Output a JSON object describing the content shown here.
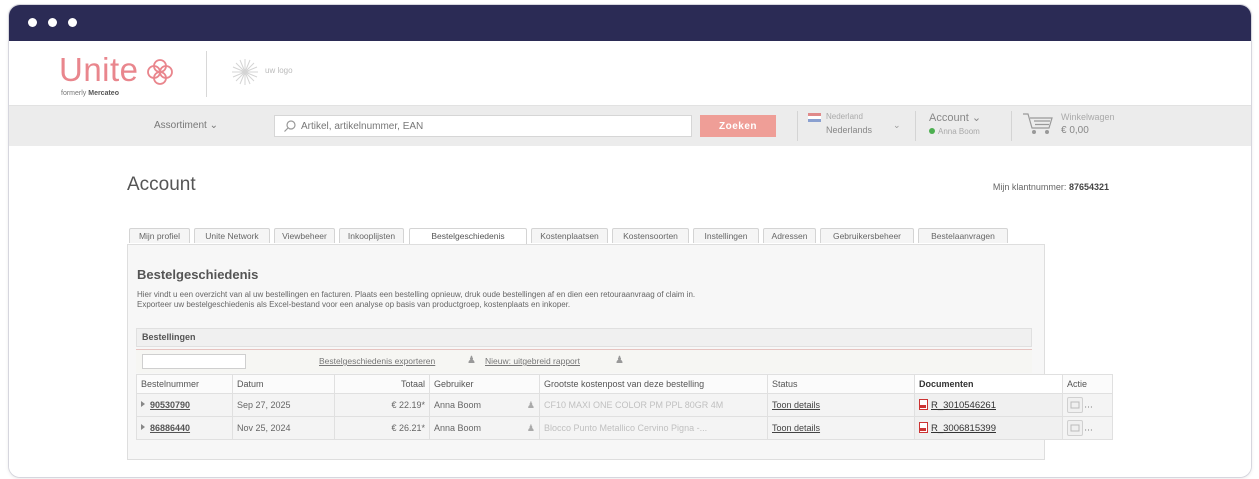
{
  "window": {
    "colors": {
      "titlebar": "#2b2b55",
      "brand": "#e9868d",
      "search_button": "#ef9e97"
    }
  },
  "header": {
    "logo_text": "Unite",
    "logo_formerly_prefix": "formerly",
    "logo_formerly_brand": "Mercateo",
    "uw_logo": "uw logo"
  },
  "nav": {
    "assortiment": "Assortiment",
    "search_placeholder": "Artikel, artikelnummer, EAN",
    "search_button": "Zoeken",
    "country": "Nederland",
    "language": "Nederlands",
    "account_label": "Account",
    "account_user": "Anna Boom",
    "cart_label": "Winkelwagen",
    "cart_total": "€ 0,00"
  },
  "page": {
    "title": "Account",
    "klant_label": "Mijn klantnummer:",
    "klant_number": "87654321"
  },
  "tabs": [
    {
      "label": "Mijn profiel"
    },
    {
      "label": "Unite Network"
    },
    {
      "label": "Viewbeheer"
    },
    {
      "label": "Inkooplijsten"
    },
    {
      "label": "Bestelgeschiedenis"
    },
    {
      "label": "Kostenplaatsen"
    },
    {
      "label": "Kostensoorten"
    },
    {
      "label": "Instellingen"
    },
    {
      "label": "Adressen"
    },
    {
      "label": "Gebruikersbeheer"
    },
    {
      "label": "Bestelaanvragen"
    }
  ],
  "section": {
    "title": "Bestelgeschiedenis",
    "desc_line1": "Hier vindt u een overzicht van al uw bestellingen en facturen. Plaats een bestelling opnieuw, druk oude bestellingen af en dien een retouraanvraag of claim in.",
    "desc_line2": "Exporteer uw bestelgeschiedenis als Excel-bestand voor een analyse op basis van productgroep, kostenplaats en inkoper.",
    "orders_header": "Bestellingen",
    "export_link": "Bestelgeschiedenis exporteren",
    "report_link": "Nieuw: uitgebreid rapport"
  },
  "table": {
    "columns": [
      "Bestelnummer",
      "Datum",
      "Totaal",
      "Gebruiker",
      "Grootste kostenpost van deze bestelling",
      "Status",
      "Documenten",
      "Actie"
    ],
    "rows": [
      {
        "order": "90530790",
        "date": "Sep 27, 2025",
        "total": "€ 22.19*",
        "user": "Anna Boom",
        "item": "CF10 MAXI ONE COLOR PM PPL 80GR 4M",
        "status": "Toon details",
        "doc": "R_3010546261"
      },
      {
        "order": "86886440",
        "date": "Nov 25, 2024",
        "total": "€ 26.21*",
        "user": "Anna Boom",
        "item": "Blocco Punto Metallico Cervino Pigna -...",
        "status": "Toon details",
        "doc": "R_3006815399"
      }
    ]
  }
}
